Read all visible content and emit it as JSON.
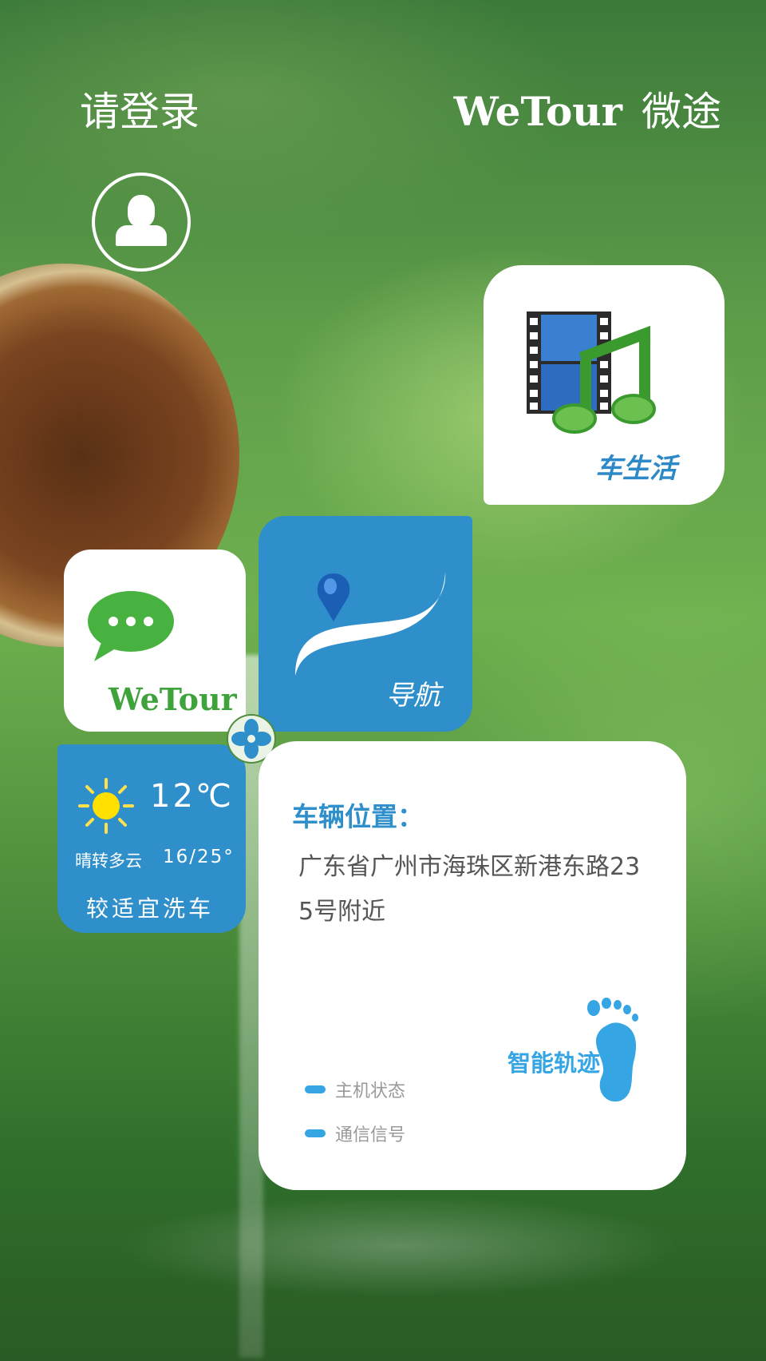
{
  "header": {
    "login_label": "请登录",
    "brand_en": "WeTour",
    "brand_cn": "微途"
  },
  "tiles": {
    "car_life": {
      "label": "车生活",
      "icon": "film-music-icon"
    },
    "wechat": {
      "label": "WeTour",
      "icon": "chat-bubble-icon",
      "color": "#3fa33b"
    },
    "navigation": {
      "label": "导航",
      "icon": "map-pin-route-icon",
      "color": "#2f8fca"
    },
    "weather": {
      "temperature": "12℃",
      "condition": "晴转多云",
      "range": "16/25°",
      "advice": "较适宜洗车",
      "icon": "sun-icon"
    }
  },
  "vehicle_location": {
    "title": "车辆位置：",
    "address": "广东省广州市海珠区新港东路235号附近",
    "smart_track_label": "智能轨迹",
    "statuses": [
      "主机状态",
      "通信信号"
    ],
    "accent": "#36a5e4"
  }
}
